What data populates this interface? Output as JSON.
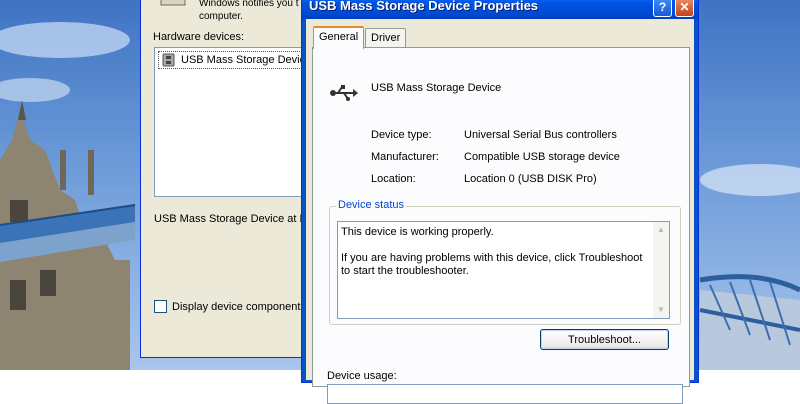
{
  "background_window": {
    "notify_text_line1": "Windows notifies you t",
    "notify_text_line2": "computer.",
    "hardware_devices_label": "Hardware devices:",
    "hardware_item": "USB Mass Storage Device",
    "description_text": "USB Mass Storage Device at L",
    "display_components_label": "Display device components"
  },
  "properties_window": {
    "title": "USB Mass Storage Device Properties",
    "help_button": "?",
    "close_button": "✕",
    "tabs": [
      {
        "label": "General",
        "selected": true
      },
      {
        "label": "Driver",
        "selected": false
      }
    ],
    "device_name": "USB Mass Storage Device",
    "properties": [
      {
        "label": "Device type:",
        "value": "Universal Serial Bus controllers"
      },
      {
        "label": "Manufacturer:",
        "value": "Compatible USB storage device"
      },
      {
        "label": "Location:",
        "value": "Location 0 (USB DISK Pro)"
      }
    ],
    "device_status": {
      "legend": "Device status",
      "text": "This device is working properly.\n\nIf you are having problems with this device, click Troubleshoot to start the troubleshooter."
    },
    "troubleshoot_button": "Troubleshoot...",
    "device_usage_label": "Device usage:"
  },
  "colors": {
    "titlebar_blue": "#0055e5",
    "dialog_face": "#ece9d8",
    "group_legend": "#0046d5",
    "close_red": "#c3411a"
  },
  "icons": [
    "usb-device-icon",
    "usb-mini-icon",
    "help-icon",
    "close-icon",
    "scroll-up-icon",
    "scroll-down-icon",
    "notify-icon"
  ]
}
